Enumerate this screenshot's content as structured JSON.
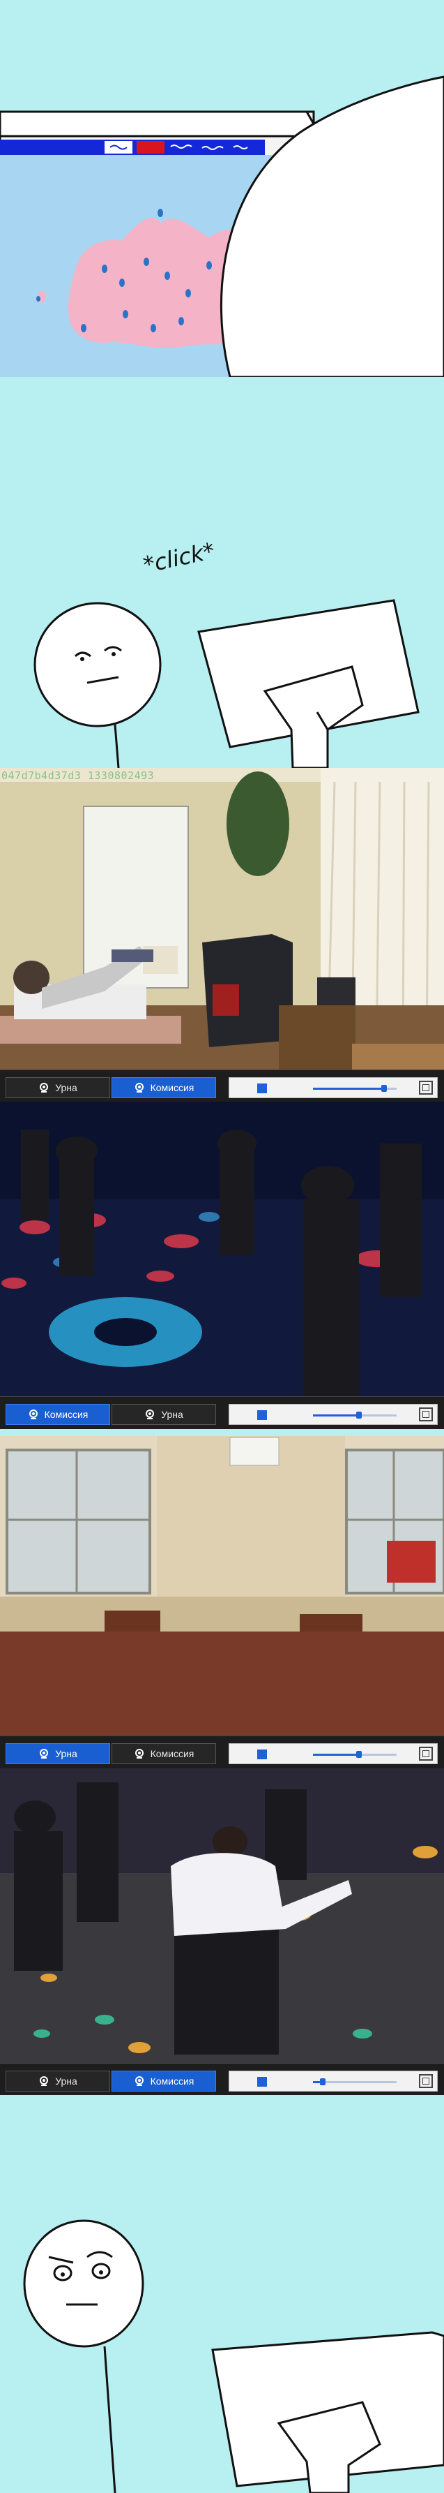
{
  "panel2": {
    "click_text": "*click*"
  },
  "frames": [
    {
      "cam_id": "047d7b4d37d3 1330802493"
    },
    {
      "cam_id": ""
    },
    {
      "cam_id": ""
    },
    {
      "cam_id": ""
    }
  ],
  "controls": [
    {
      "tab1": "Урна",
      "tab2": "Комиссия",
      "active": "tab2",
      "volume": 0.85
    },
    {
      "tab1": "Комиссия",
      "tab2": "Урна",
      "active": "tab1",
      "volume": 0.55
    },
    {
      "tab1": "Урна",
      "tab2": "Комиссия",
      "active": "tab1",
      "volume": 0.55
    },
    {
      "tab1": "Урна",
      "tab2": "Комиссия",
      "active": "tab2",
      "volume": 0.12
    }
  ],
  "colors": {
    "cyan": "#b8f0f2",
    "accent": "#1a5fd1",
    "bar": "#1d1d1d"
  }
}
